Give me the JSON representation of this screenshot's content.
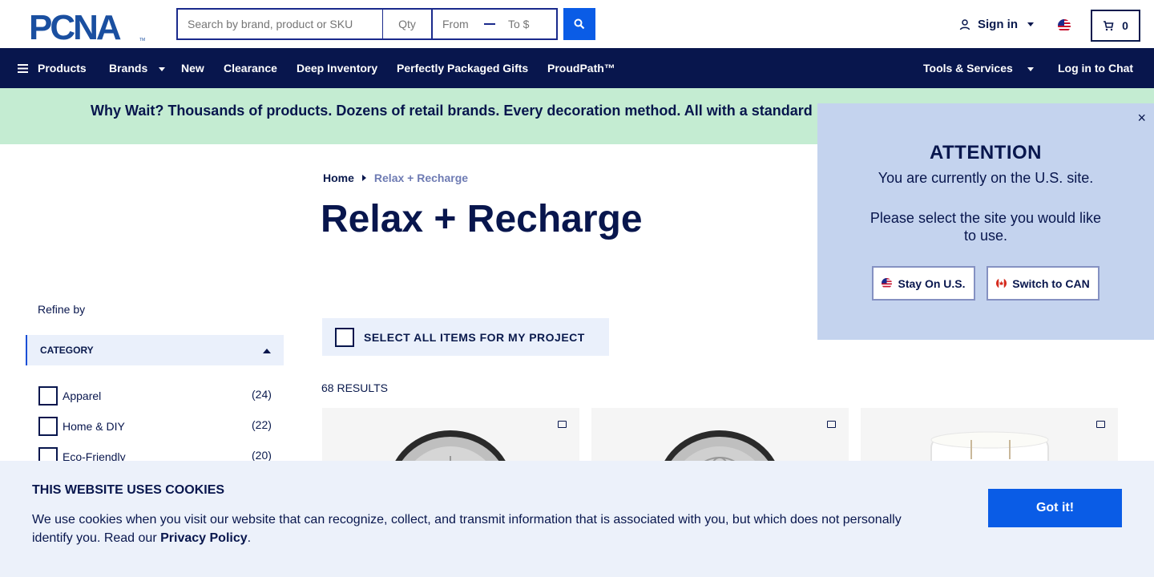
{
  "header": {
    "logo_text": "PCNA",
    "search_placeholder": "Search by brand, product or SKU",
    "qty_placeholder": "Qty",
    "from_placeholder": "From $",
    "to_placeholder": "To $",
    "signin_label": "Sign in",
    "cart_count": "0"
  },
  "nav": {
    "products": "Products",
    "brands": "Brands",
    "new": "New",
    "clearance": "Clearance",
    "deep_inventory": "Deep Inventory",
    "gifts": "Perfectly Packaged Gifts",
    "proudpath": "ProudPath™",
    "tools": "Tools & Services",
    "chat": "Log in to Chat"
  },
  "banner": {
    "text": "Why Wait? Thousands of products. Dozens of retail brands. Every decoration method. All with a standard"
  },
  "breadcrumb": {
    "home": "Home",
    "current": "Relax + Recharge"
  },
  "page_title": "Relax + Recharge",
  "sidebar": {
    "refine_label": "Refine by",
    "category_label": "CATEGORY",
    "items": [
      {
        "label": "Apparel",
        "count": "(24)"
      },
      {
        "label": "Home & DIY",
        "count": "(22)"
      },
      {
        "label": "Eco-Friendly",
        "count": "(20)"
      }
    ]
  },
  "main": {
    "select_all_label": "SELECT ALL ITEMS FOR MY PROJECT",
    "results_label": "68 RESULTS"
  },
  "popup": {
    "title": "ATTENTION",
    "line1": "You are currently on the U.S. site.",
    "line2": "Please select the site you would like to use.",
    "stay_label": "Stay On U.S.",
    "switch_label": "Switch to CAN",
    "close_symbol": "×"
  },
  "cookie": {
    "title": "THIS WEBSITE USES COOKIES",
    "text": "We use cookies when you visit our website that can recognize, collect, and transmit information that is associated with you, but which does not personally identify you. Read our",
    "link": "Privacy Policy",
    "end": ".",
    "button": "Got it!"
  },
  "colors": {
    "navy": "#08164d",
    "accent_blue": "#0a5ce6",
    "banner_green": "#c4ecd2",
    "popup_blue": "#c4d3ee"
  }
}
